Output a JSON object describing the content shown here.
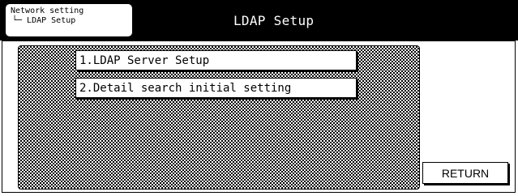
{
  "header": {
    "breadcrumb_parent": "Network setting",
    "breadcrumb_child": "└─ LDAP Setup",
    "title": "LDAP Setup"
  },
  "menu": {
    "items": [
      {
        "label": "1.LDAP Server Setup"
      },
      {
        "label": "2.Detail search initial setting"
      }
    ]
  },
  "footer": {
    "return_label": "RETURN"
  }
}
